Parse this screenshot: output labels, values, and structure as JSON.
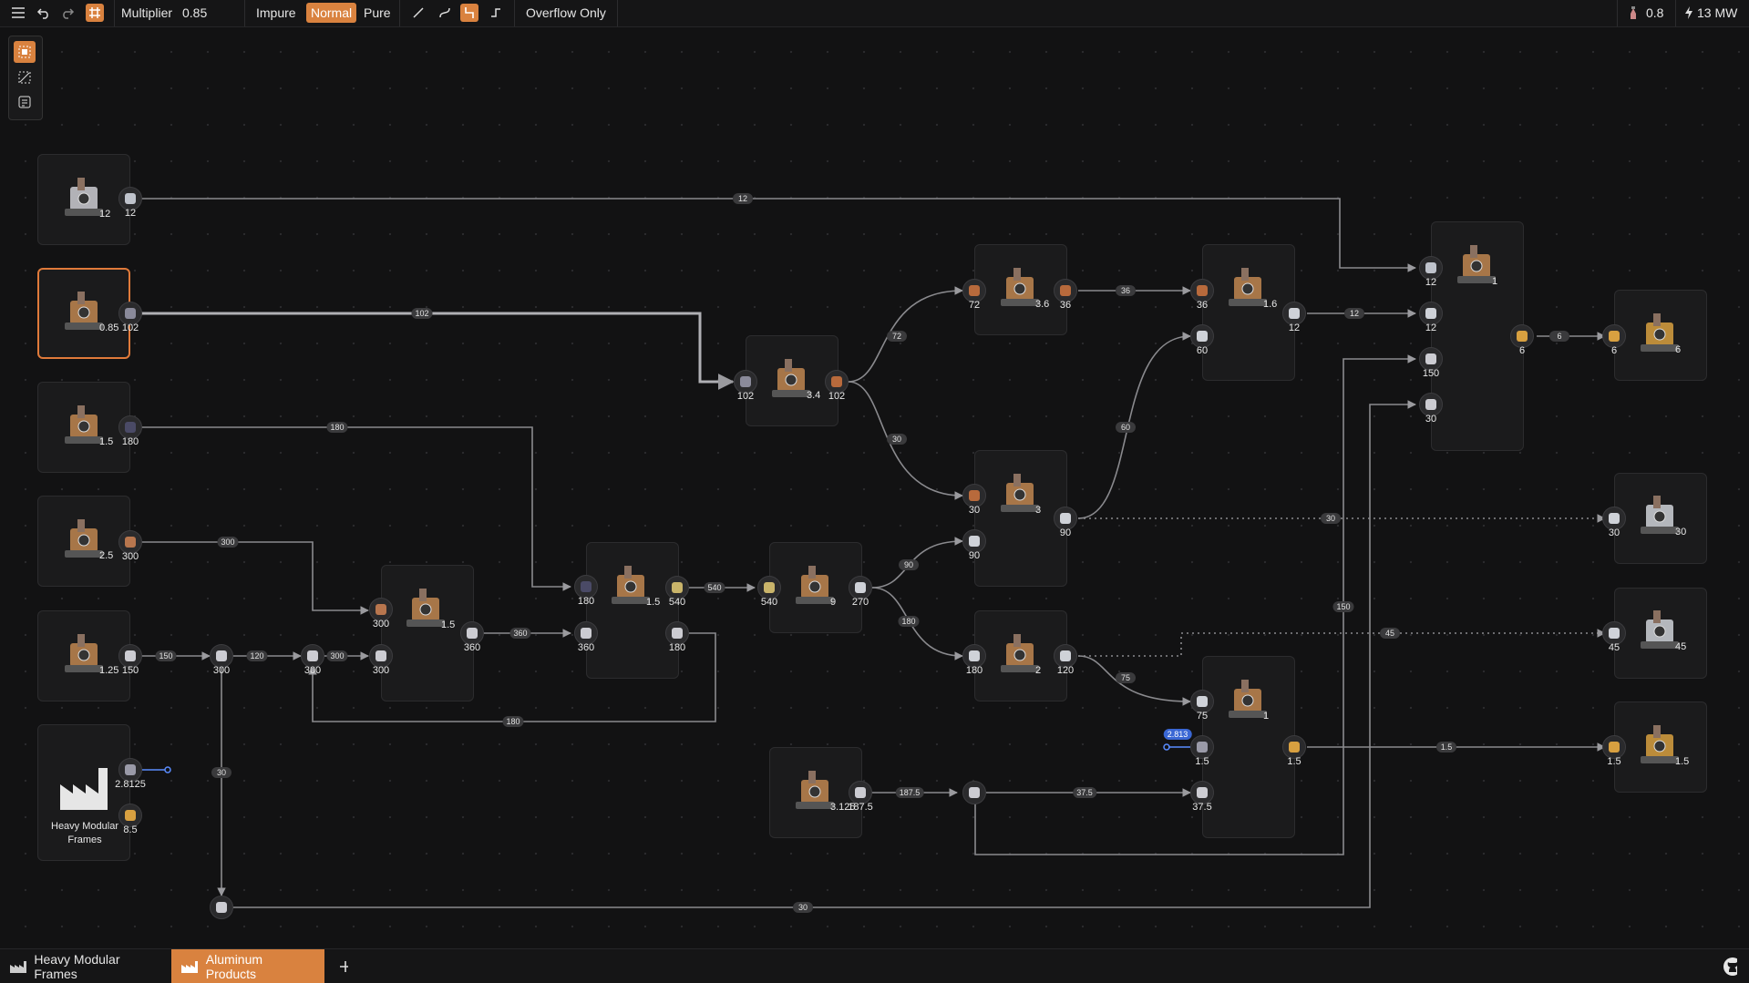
{
  "topbar": {
    "multiplier_label": "Multiplier",
    "multiplier_value": "0.85",
    "purity": [
      "Impure",
      "Normal",
      "Pure"
    ],
    "purity_selected": "Normal",
    "overflow_label": "Overflow Only",
    "clock_value": "0.8",
    "power_value": "13 MW"
  },
  "tabs": [
    {
      "label": "Heavy Modular Frames",
      "active": false
    },
    {
      "label": "Aluminum Products",
      "active": true
    }
  ],
  "factory_node": {
    "label": "Heavy Modular Frames",
    "in_value": "2.8125",
    "out_value": "8.5"
  },
  "machines": [
    {
      "id": "m1",
      "count": "12"
    },
    {
      "id": "m2",
      "count": "0.85"
    },
    {
      "id": "m3",
      "count": "1.5"
    },
    {
      "id": "m4",
      "count": "2.5"
    },
    {
      "id": "m5",
      "count": "1.25"
    },
    {
      "id": "m6",
      "count": "1.5"
    },
    {
      "id": "m7",
      "count": "1.5"
    },
    {
      "id": "m8",
      "count": "3.4"
    },
    {
      "id": "m9",
      "count": "9"
    },
    {
      "id": "m10",
      "count": "3.6"
    },
    {
      "id": "m11",
      "count": "3"
    },
    {
      "id": "m12",
      "count": "2"
    },
    {
      "id": "m13",
      "count": "1.6"
    },
    {
      "id": "m14",
      "count": "1"
    },
    {
      "id": "m15",
      "count": "1"
    },
    {
      "id": "m16",
      "count": "3.125"
    },
    {
      "id": "m17",
      "count": "6"
    },
    {
      "id": "m18",
      "count": "30"
    },
    {
      "id": "m19",
      "count": "45"
    },
    {
      "id": "m20",
      "count": "1.5"
    }
  ],
  "ports": [
    {
      "id": "p1",
      "value": "12"
    },
    {
      "id": "p2",
      "value": "102"
    },
    {
      "id": "p3",
      "value": "180"
    },
    {
      "id": "p4",
      "value": "300"
    },
    {
      "id": "p5",
      "value": "150"
    },
    {
      "id": "p6",
      "value": "300"
    },
    {
      "id": "p7",
      "value": "300"
    },
    {
      "id": "p8",
      "value": "360"
    },
    {
      "id": "p9",
      "value": "180"
    },
    {
      "id": "p10",
      "value": "360"
    },
    {
      "id": "p11",
      "value": "540"
    },
    {
      "id": "p12",
      "value": "180"
    },
    {
      "id": "p13",
      "value": "102"
    },
    {
      "id": "p14",
      "value": "102"
    },
    {
      "id": "p15",
      "value": "540"
    },
    {
      "id": "p16",
      "value": "270"
    },
    {
      "id": "p17",
      "value": "72"
    },
    {
      "id": "p18",
      "value": "36"
    },
    {
      "id": "p19",
      "value": "30"
    },
    {
      "id": "p20",
      "value": "90"
    },
    {
      "id": "p21",
      "value": "90"
    },
    {
      "id": "p22",
      "value": "180"
    },
    {
      "id": "p23",
      "value": "120"
    },
    {
      "id": "p24",
      "value": "36"
    },
    {
      "id": "p25",
      "value": "60"
    },
    {
      "id": "p26",
      "value": "12"
    },
    {
      "id": "p27",
      "value": "12"
    },
    {
      "id": "p28",
      "value": "12"
    },
    {
      "id": "p29",
      "value": "150"
    },
    {
      "id": "p30",
      "value": "30"
    },
    {
      "id": "p31",
      "value": "6"
    },
    {
      "id": "p32",
      "value": "75"
    },
    {
      "id": "p33",
      "value": "1.5"
    },
    {
      "id": "p34",
      "value": "37.5"
    },
    {
      "id": "p35",
      "value": "1.5"
    },
    {
      "id": "p36",
      "value": "187.5"
    },
    {
      "id": "p37",
      "value": "6"
    },
    {
      "id": "p38",
      "value": "30"
    },
    {
      "id": "p39",
      "value": "45"
    },
    {
      "id": "p40",
      "value": "1.5"
    }
  ],
  "edge_labels": [
    {
      "id": "e1",
      "value": "12"
    },
    {
      "id": "e2",
      "value": "102"
    },
    {
      "id": "e3",
      "value": "180"
    },
    {
      "id": "e4",
      "value": "300"
    },
    {
      "id": "e5",
      "value": "150"
    },
    {
      "id": "e6",
      "value": "120"
    },
    {
      "id": "e7",
      "value": "300"
    },
    {
      "id": "e8",
      "value": "360"
    },
    {
      "id": "e9",
      "value": "180"
    },
    {
      "id": "e10",
      "value": "540"
    },
    {
      "id": "e11",
      "value": "72"
    },
    {
      "id": "e12",
      "value": "30"
    },
    {
      "id": "e13",
      "value": "90"
    },
    {
      "id": "e14",
      "value": "180"
    },
    {
      "id": "e15",
      "value": "36"
    },
    {
      "id": "e16",
      "value": "60"
    },
    {
      "id": "e17",
      "value": "12"
    },
    {
      "id": "e18",
      "value": "6"
    },
    {
      "id": "e19",
      "value": "30"
    },
    {
      "id": "e20",
      "value": "45"
    },
    {
      "id": "e21",
      "value": "75"
    },
    {
      "id": "e22",
      "value": "2.813"
    },
    {
      "id": "e23",
      "value": "1.5"
    },
    {
      "id": "e24",
      "value": "187.5"
    },
    {
      "id": "e25",
      "value": "37.5"
    },
    {
      "id": "e26",
      "value": "150"
    },
    {
      "id": "e27",
      "value": "30"
    },
    {
      "id": "e28",
      "value": "30"
    }
  ],
  "colors": {
    "accent": "#d9823f",
    "edge": "#8e8e92",
    "selected": "#e07a3a",
    "blue": "#3a67d4"
  }
}
